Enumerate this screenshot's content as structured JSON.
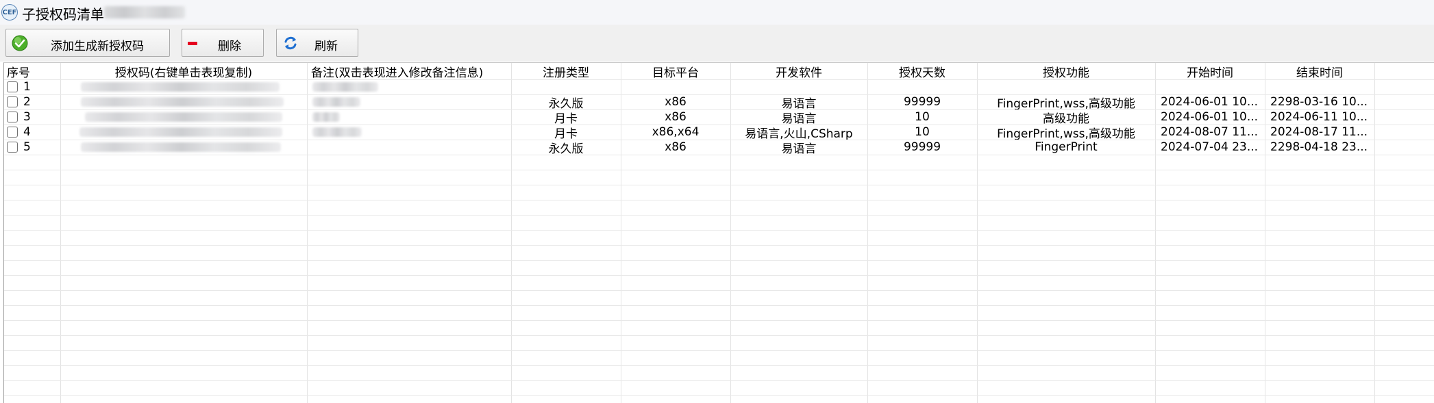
{
  "window": {
    "title": "子授权码清单",
    "icon": "cef-app-icon"
  },
  "toolbar": {
    "add_label": "添加生成新授权码",
    "delete_label": "删除",
    "refresh_label": "刷新"
  },
  "table": {
    "headers": [
      "序号",
      "授权码(右键单击表现复制)",
      "备注(双击表现进入修改备注信息)",
      "注册类型",
      "目标平台",
      "开发软件",
      "授权天数",
      "授权功能",
      "开始时间",
      "结束时间"
    ],
    "rows": [
      {
        "seq": "1",
        "reg_type": "",
        "platform": "",
        "dev_software": "",
        "days": "",
        "features": "",
        "start": "",
        "end": ""
      },
      {
        "seq": "2",
        "reg_type": "永久版",
        "platform": "x86",
        "dev_software": "易语言",
        "days": "99999",
        "features": "FingerPrint,wss,高级功能",
        "start": "2024-06-01 10...",
        "end": "2298-03-16 10..."
      },
      {
        "seq": "3",
        "reg_type": "月卡",
        "platform": "x86",
        "dev_software": "易语言",
        "days": "10",
        "features": "高级功能",
        "start": "2024-06-01 10...",
        "end": "2024-06-11 10..."
      },
      {
        "seq": "4",
        "reg_type": "月卡",
        "platform": "x86,x64",
        "dev_software": "易语言,火山,CSharp",
        "days": "10",
        "features": "FingerPrint,wss,高级功能",
        "start": "2024-08-07 11...",
        "end": "2024-08-17 11..."
      },
      {
        "seq": "5",
        "reg_type": "永久版",
        "platform": "x86",
        "dev_software": "易语言",
        "days": "99999",
        "features": "FingerPrint",
        "start": "2024-07-04 23...",
        "end": "2298-04-18 23..."
      }
    ]
  }
}
